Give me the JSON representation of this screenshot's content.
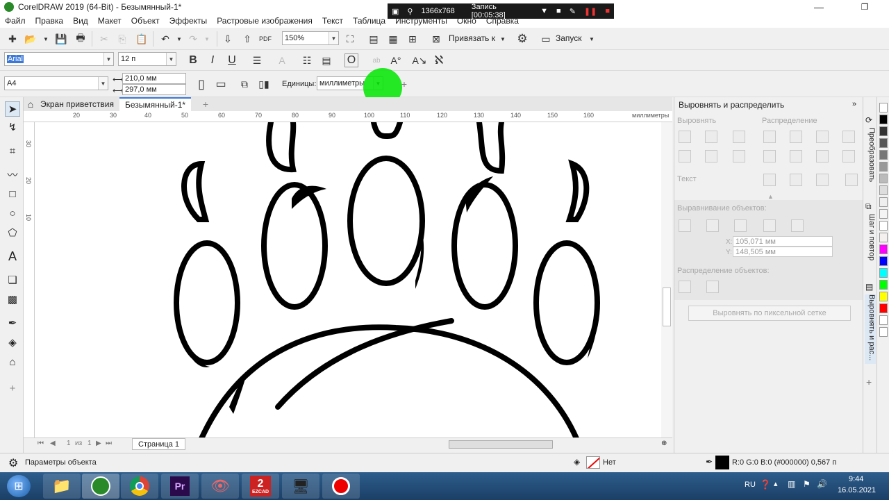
{
  "window": {
    "title": "CorelDRAW 2019 (64-Bit) - Безымянный-1*"
  },
  "recorder": {
    "resolution": "1366x768",
    "record_label": "Запись [00:05:38]"
  },
  "menu": [
    "Файл",
    "Правка",
    "Вид",
    "Макет",
    "Объект",
    "Эффекты",
    "Растровые изображения",
    "Текст",
    "Таблица",
    "Инструменты",
    "Окно",
    "Справка"
  ],
  "toolbar": {
    "zoom": "150%",
    "snap_label": "Привязать к",
    "launch_label": "Запуск"
  },
  "textbar": {
    "font": "Arial",
    "size": "12 п"
  },
  "propbar": {
    "page_size": "A4",
    "width": "210,0 мм",
    "height": "297,0 мм",
    "units_label": "Единицы:",
    "units_value": "миллиметры"
  },
  "tabs": {
    "welcome": "Экран приветствия",
    "doc": "Безымянный-1*"
  },
  "ruler": {
    "units": "миллиметры",
    "h_ticks": [
      "20",
      "30",
      "40",
      "50",
      "60",
      "70",
      "80",
      "90",
      "100",
      "110",
      "120",
      "130",
      "140",
      "150",
      "160"
    ],
    "v_ticks": [
      "30",
      "20",
      "10"
    ]
  },
  "pagenav": {
    "current": "1",
    "of": "из",
    "total": "1",
    "page_tab": "Страница 1"
  },
  "docker": {
    "title": "Выровнять и распределить",
    "align": "Выровнять",
    "distribute": "Распределение",
    "text": "Текст",
    "object_alignment": "Выравнивание объектов:",
    "x_value": "105,071 мм",
    "y_value": "148,505 мм",
    "object_distribution": "Распределение объектов:",
    "pixel_grid_button": "Выровнять по пиксельной сетке"
  },
  "side_tabs": [
    "Преобразовать",
    "Шаг и повтор",
    "Выровнять и рас..."
  ],
  "palette": [
    "#ffffff",
    "#000000",
    "#333333",
    "#555555",
    "#777777",
    "#999999",
    "#bbbbbb",
    "#dddddd",
    "#eeeeee",
    "#f4f4f4",
    "#ffffff",
    "#f5f0f0",
    "#ff00ff",
    "#0000ff",
    "#00ffff",
    "#00ff00",
    "#ffff00",
    "#ff0000",
    "#ffffff",
    "#ffffff"
  ],
  "status": {
    "object_params": "Параметры объекта",
    "fill": "Нет",
    "outline": "R:0 G:0 B:0 (#000000)  0,567 п"
  },
  "taskbar": {
    "lang": "RU",
    "time": "9:44",
    "date": "16.05.2021",
    "ezcad_label": "EZCAD"
  }
}
